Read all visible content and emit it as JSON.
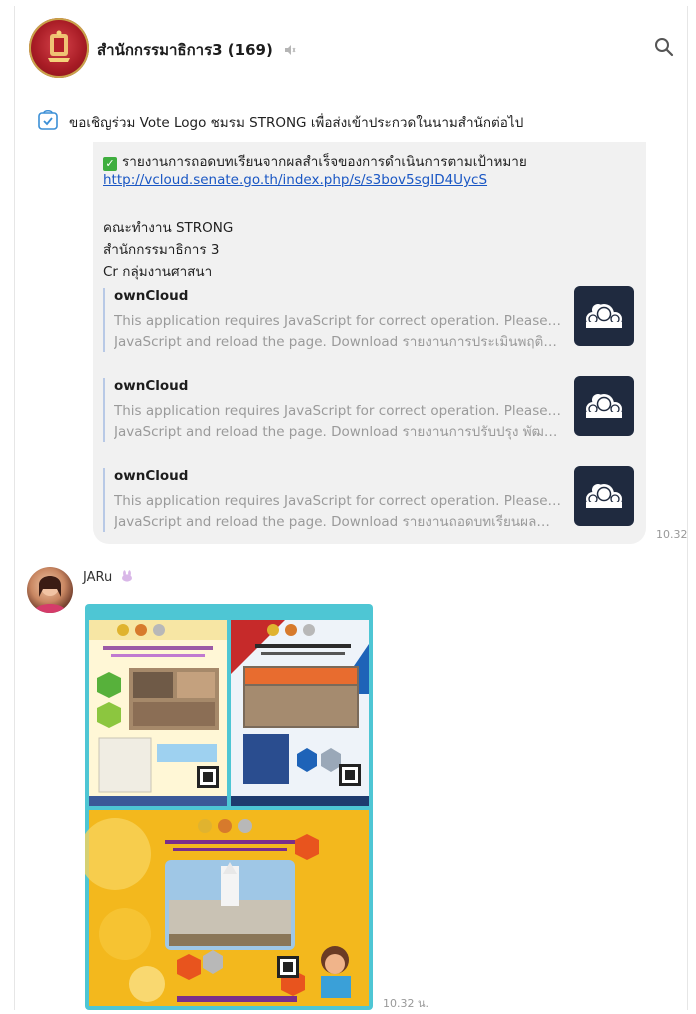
{
  "header": {
    "group_name": "สำนักกรรมาธิการ3 (169)"
  },
  "pinned": {
    "text": "ขอเชิญร่วม Vote Logo ชมรม STRONG เพื่อส่งเข้าประกวดในนามสำนักต่อไป"
  },
  "message": {
    "report_line": "รายงานการถอดบทเรียนจากผลสำเร็จของการดำเนินการตามเป้าหมาย",
    "link": "http://vcloud.senate.go.th/index.php/s/s3bov5sgID4UycS",
    "team_line": "คณะทำงาน STRONG",
    "office_line": "สำนักกรรมาธิการ 3",
    "credit_line": "Cr กลุ่มงานศาสนา",
    "previews": [
      {
        "title": "ownCloud",
        "line1": "This application requires JavaScript for correct operation. Please enable",
        "line2": "JavaScript and reload the page. Download รายงานการประเมินพฤติกรรมตา..."
      },
      {
        "title": "ownCloud",
        "line1": "This application requires JavaScript for correct operation. Please enable",
        "line2": "JavaScript and reload the page. Download รายงานการปรับปรุง พัฒนาการ..."
      },
      {
        "title": "ownCloud",
        "line1": "This application requires JavaScript for correct operation. Please enable",
        "line2": "JavaScript and reload the page. Download รายงานถอดบทเรียนผลสำเร็จตา..."
      }
    ],
    "time": "10.32"
  },
  "second_message": {
    "sender": "JARu",
    "time": "10.32 น."
  },
  "colors": {
    "link": "#1a57c4",
    "bubble": "#f1f1f1",
    "check": "#3fae3f",
    "owncloud_thumb": "#1f2a3f"
  }
}
